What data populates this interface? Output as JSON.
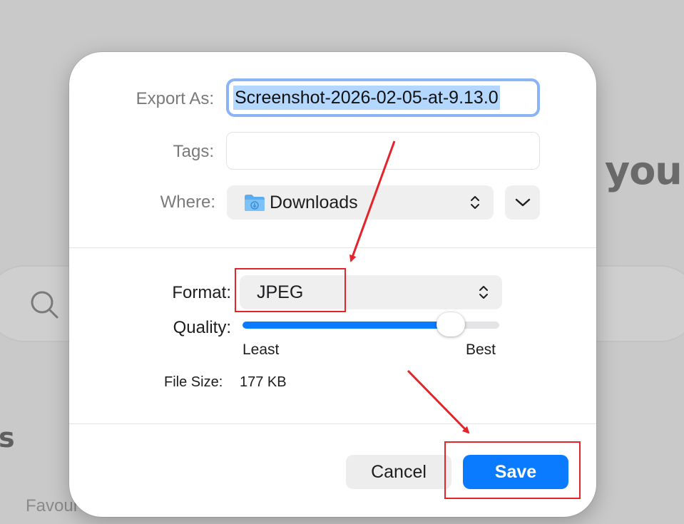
{
  "background": {
    "heading_fragment": "you",
    "section_fragment": "s",
    "sidebar_fragment": "Favour"
  },
  "dialog": {
    "export_as": {
      "label": "Export As:",
      "value": "Screenshot-2026-02-05-at-9.13.0"
    },
    "tags": {
      "label": "Tags:",
      "value": ""
    },
    "where": {
      "label": "Where:",
      "value": "Downloads",
      "icon": "downloads-folder-icon"
    },
    "format": {
      "label": "Format:",
      "value": "JPEG"
    },
    "quality": {
      "label": "Quality:",
      "min_label": "Least",
      "max_label": "Best",
      "level": 0.81
    },
    "file_size": {
      "label": "File Size:",
      "value": "177 KB"
    },
    "buttons": {
      "cancel": "Cancel",
      "save": "Save"
    }
  },
  "colors": {
    "accent": "#0a7bff",
    "annotation": "#e3242b",
    "focus_ring": "#8ab4f6",
    "selection": "#b3d7ff"
  }
}
